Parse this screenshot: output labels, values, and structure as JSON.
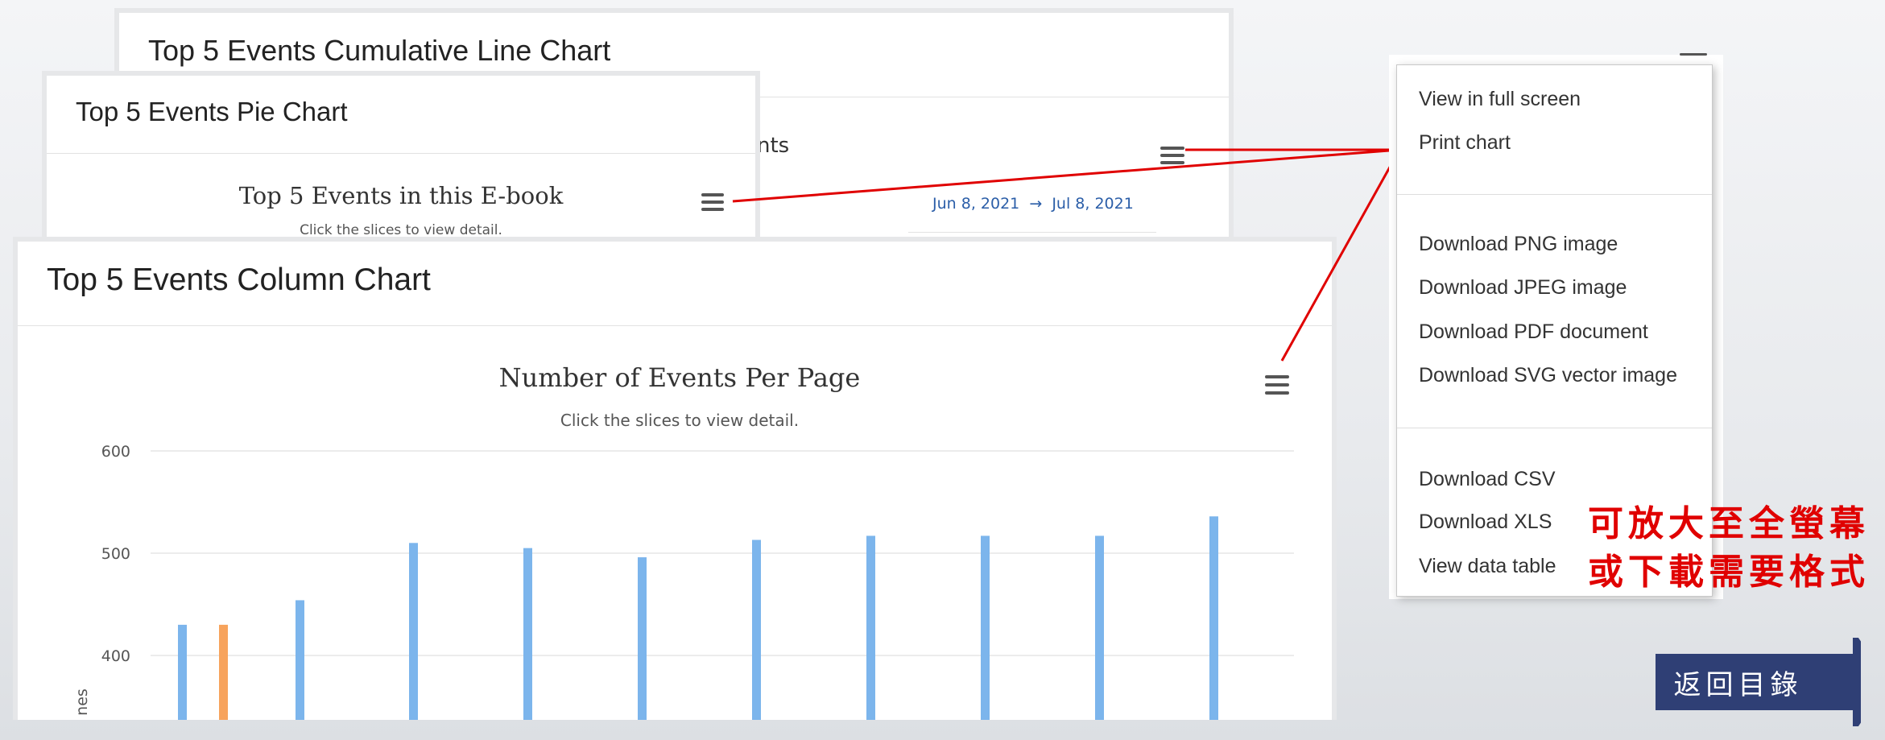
{
  "cumulative_panel": {
    "title": "Top 5 Events Cumulative Line Chart",
    "partial_chart_title": "nts",
    "date_range": "Jun 8, 2021  →  Jul 8, 2021"
  },
  "pie_panel": {
    "title": "Top 5 Events Pie Chart",
    "chart_title": "Top 5 Events in this E-book",
    "chart_subtitle": "Click the slices to view detail."
  },
  "column_panel": {
    "title": "Top 5 Events Column Chart",
    "chart_title": "Number of Events Per Page",
    "chart_subtitle": "Click the slices to view detail.",
    "y_axis_label_fragment": "nes"
  },
  "chart_data": {
    "type": "bar",
    "title": "Number of Events Per Page",
    "subtitle": "Click the slices to view detail.",
    "xlabel": "",
    "ylabel": "nes",
    "y_ticks": [
      600,
      500,
      400
    ],
    "ylim": [
      345,
      630
    ],
    "grid": true,
    "bars": [
      {
        "value": 430,
        "color": "#7cb5ec"
      },
      {
        "value": 430,
        "color": "#f7a35c"
      },
      {
        "value": 454,
        "color": "#7cb5ec"
      },
      {
        "value": 510,
        "color": "#7cb5ec"
      },
      {
        "value": 505,
        "color": "#7cb5ec"
      },
      {
        "value": 496,
        "color": "#7cb5ec"
      },
      {
        "value": 513,
        "color": "#7cb5ec"
      },
      {
        "value": 517,
        "color": "#7cb5ec"
      },
      {
        "value": 517,
        "color": "#7cb5ec"
      },
      {
        "value": 517,
        "color": "#7cb5ec"
      },
      {
        "value": 536,
        "color": "#7cb5ec"
      }
    ]
  },
  "menu": {
    "groups": [
      [
        "View in full screen",
        "Print chart"
      ],
      [
        "Download PNG image",
        "Download JPEG image",
        "Download PDF document",
        "Download SVG vector image"
      ],
      [
        "Download CSV",
        "Download XLS",
        "View data table"
      ]
    ]
  },
  "annotation": {
    "line1": "可放大至全螢幕",
    "line2": "或下載需要格式"
  },
  "back_button": {
    "label": "返回目錄"
  },
  "colors": {
    "series_blue": "#7cb5ec",
    "series_orange": "#f7a35c",
    "connector_red": "#e00000",
    "annotation_red": "#e00000",
    "back_button_bg": "#2f3f75"
  },
  "icons": [
    "hamburger-menu-icon",
    "arrow-right-icon"
  ]
}
